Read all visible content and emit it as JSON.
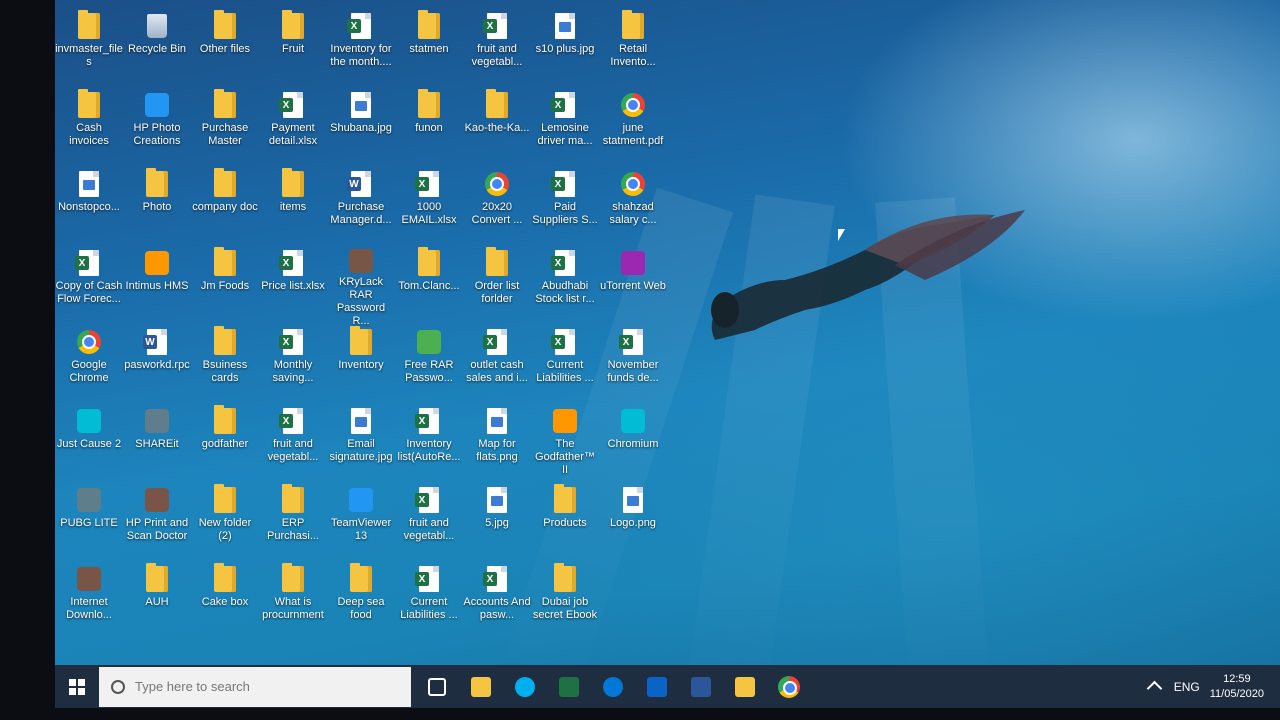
{
  "desktop": {
    "icons": [
      {
        "label": "invmaster_files",
        "type": "folder"
      },
      {
        "label": "Recycle Bin",
        "type": "recycle"
      },
      {
        "label": "Other files",
        "type": "folder"
      },
      {
        "label": "Fruit",
        "type": "folder"
      },
      {
        "label": "Inventory for the month....",
        "type": "excel"
      },
      {
        "label": "statmen",
        "type": "folder"
      },
      {
        "label": "fruit and vegetabl...",
        "type": "excel"
      },
      {
        "label": "s10 plus.jpg",
        "type": "image"
      },
      {
        "label": "Retail Invento...",
        "type": "folder"
      },
      {
        "label": "Cash invoices",
        "type": "folder"
      },
      {
        "label": "HP Photo Creations",
        "type": "app"
      },
      {
        "label": "Purchase Master",
        "type": "folder"
      },
      {
        "label": "Payment detail.xlsx",
        "type": "excel"
      },
      {
        "label": "Shubana.jpg",
        "type": "image"
      },
      {
        "label": "funon",
        "type": "folder"
      },
      {
        "label": "Kao-the-Ka...",
        "type": "folder"
      },
      {
        "label": "Lemosine driver ma...",
        "type": "excel"
      },
      {
        "label": "june statment.pdf",
        "type": "chrome"
      },
      {
        "label": "Nonstopco...",
        "type": "image"
      },
      {
        "label": "Photo",
        "type": "folder"
      },
      {
        "label": "company doc",
        "type": "folder"
      },
      {
        "label": "items",
        "type": "folder"
      },
      {
        "label": "Purchase Manager.d...",
        "type": "word"
      },
      {
        "label": "1000 EMAIL.xlsx",
        "type": "excel"
      },
      {
        "label": "20x20 Convert ...",
        "type": "chrome"
      },
      {
        "label": "Paid Suppliers S...",
        "type": "excel"
      },
      {
        "label": "shahzad salary c...",
        "type": "chrome"
      },
      {
        "label": "Copy of Cash Flow Forec...",
        "type": "excel"
      },
      {
        "label": "Intimus HMS",
        "type": "app"
      },
      {
        "label": "Jm Foods",
        "type": "folder"
      },
      {
        "label": "Price list.xlsx",
        "type": "excel"
      },
      {
        "label": "KRyLack RAR Password R...",
        "type": "app"
      },
      {
        "label": "Tom.Clanc...",
        "type": "folder"
      },
      {
        "label": "Order list forlder",
        "type": "folder"
      },
      {
        "label": "Abudhabi Stock list r...",
        "type": "excel"
      },
      {
        "label": "uTorrent Web",
        "type": "app"
      },
      {
        "label": "Google Chrome",
        "type": "chrome"
      },
      {
        "label": "pasworkd.rpc",
        "type": "word"
      },
      {
        "label": "Bsuiness cards",
        "type": "folder"
      },
      {
        "label": "Monthly saving...",
        "type": "excel"
      },
      {
        "label": "Inventory",
        "type": "folder"
      },
      {
        "label": "Free RAR Passwo...",
        "type": "app"
      },
      {
        "label": "outlet cash sales and i...",
        "type": "excel"
      },
      {
        "label": "Current Liabilities ...",
        "type": "excel"
      },
      {
        "label": "November funds de...",
        "type": "excel"
      },
      {
        "label": "Just Cause 2",
        "type": "app"
      },
      {
        "label": "SHAREit",
        "type": "app"
      },
      {
        "label": "godfather",
        "type": "folder"
      },
      {
        "label": "fruit and vegetabl...",
        "type": "excel"
      },
      {
        "label": "Email signature.jpg",
        "type": "image"
      },
      {
        "label": "Inventory list(AutoRe...",
        "type": "excel"
      },
      {
        "label": "Map for flats.png",
        "type": "image"
      },
      {
        "label": "The Godfather™ II",
        "type": "app"
      },
      {
        "label": "Chromium",
        "type": "app"
      },
      {
        "label": "PUBG LITE",
        "type": "app"
      },
      {
        "label": "HP Print and Scan Doctor",
        "type": "app"
      },
      {
        "label": "New folder (2)",
        "type": "folder"
      },
      {
        "label": "ERP Purchasi...",
        "type": "folder"
      },
      {
        "label": "TeamViewer 13",
        "type": "app"
      },
      {
        "label": "fruit and vegetabl...",
        "type": "excel"
      },
      {
        "label": "5.jpg",
        "type": "image"
      },
      {
        "label": "Products",
        "type": "folder"
      },
      {
        "label": "Logo.png",
        "type": "image"
      },
      {
        "label": "Internet Downlo...",
        "type": "app"
      },
      {
        "label": "AUH",
        "type": "folder"
      },
      {
        "label": "Cake box",
        "type": "folder"
      },
      {
        "label": "What is procurnment",
        "type": "folder"
      },
      {
        "label": "Deep sea food",
        "type": "folder"
      },
      {
        "label": "Current Liabilities ...",
        "type": "excel"
      },
      {
        "label": "Accounts And pasw...",
        "type": "excel"
      },
      {
        "label": "Dubai job secret Ebook",
        "type": "folder"
      },
      {
        "label": "",
        "type": "none"
      }
    ]
  },
  "taskbar": {
    "search_placeholder": "Type here to search",
    "pinned": [
      {
        "name": "task-view",
        "color": "#ffffff"
      },
      {
        "name": "store",
        "color": "#f5c542"
      },
      {
        "name": "skype",
        "color": "#00aff0"
      },
      {
        "name": "excel",
        "color": "#1e7145"
      },
      {
        "name": "edge",
        "color": "#0078d7"
      },
      {
        "name": "outlook",
        "color": "#0a64c8"
      },
      {
        "name": "word",
        "color": "#2b579a"
      },
      {
        "name": "file-explorer",
        "color": "#f5c542"
      },
      {
        "name": "chrome",
        "color": "#ea4335"
      }
    ],
    "tray": {
      "language": "ENG",
      "time": "12:59",
      "date": "11/05/2020"
    }
  }
}
